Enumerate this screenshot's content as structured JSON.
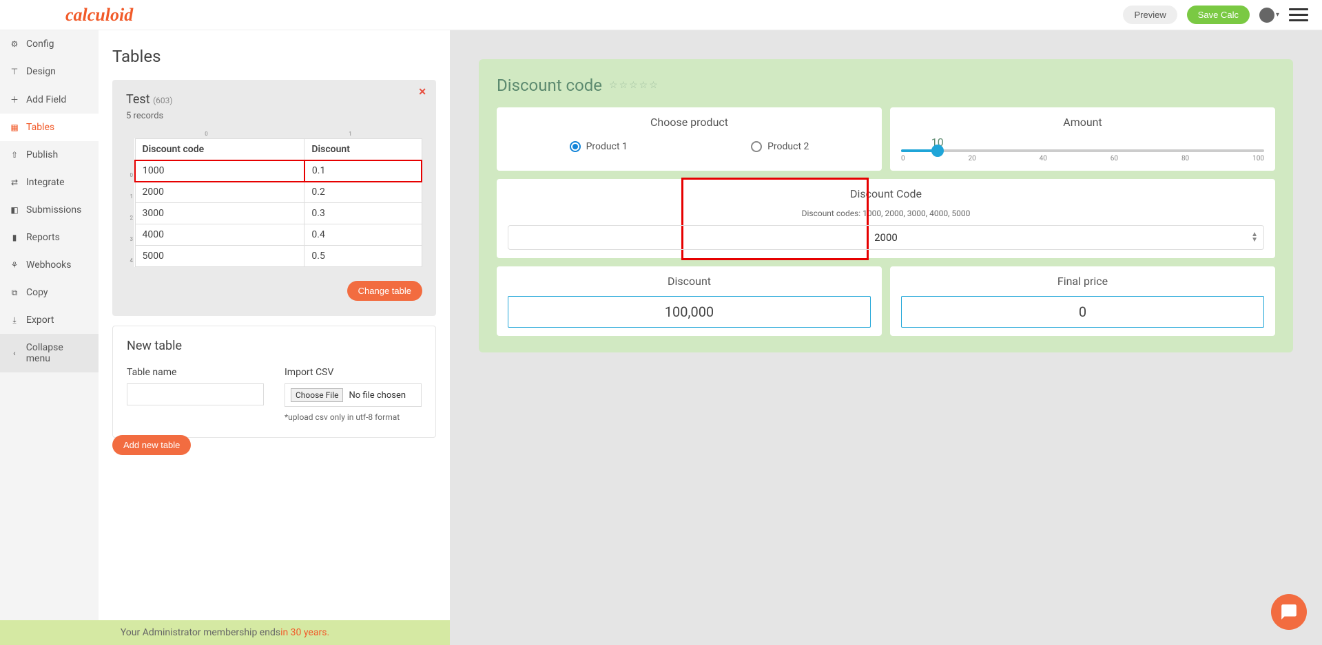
{
  "logo": "calculoid",
  "topbar": {
    "preview": "Preview",
    "save": "Save Calc"
  },
  "sidebar": {
    "items": [
      {
        "label": "Config"
      },
      {
        "label": "Design"
      },
      {
        "label": "Add Field"
      },
      {
        "label": "Tables"
      },
      {
        "label": "Publish"
      },
      {
        "label": "Integrate"
      },
      {
        "label": "Submissions"
      },
      {
        "label": "Reports"
      },
      {
        "label": "Webhooks"
      },
      {
        "label": "Copy"
      },
      {
        "label": "Export"
      }
    ],
    "collapse": "Collapse menu"
  },
  "tables": {
    "title": "Tables",
    "table_name": "Test",
    "table_id": "(603)",
    "record_text": "5 records",
    "col_index": [
      "0",
      "1"
    ],
    "row_index": [
      "0",
      "1",
      "2",
      "3",
      "4"
    ],
    "headers": [
      "Discount code",
      "Discount"
    ],
    "rows": [
      [
        "1000",
        "0.1"
      ],
      [
        "2000",
        "0.2"
      ],
      [
        "3000",
        "0.3"
      ],
      [
        "4000",
        "0.4"
      ],
      [
        "5000",
        "0.5"
      ]
    ],
    "change_btn": "Change table",
    "new_table_title": "New table",
    "table_name_label": "Table name",
    "import_csv_label": "Import CSV",
    "choose_file_btn": "Choose File",
    "no_file": "No file chosen",
    "upload_note": "*upload csv only in utf-8 format",
    "add_btn": "Add new table"
  },
  "membership": {
    "prefix": "Your Administrator membership ends ",
    "highlight": "in 30 years."
  },
  "calc": {
    "title": "Discount code",
    "product_card_title": "Choose product",
    "product1": "Product 1",
    "product2": "Product 2",
    "amount_title": "Amount",
    "slider_value": "10",
    "slider_ticks": [
      "0",
      "20",
      "40",
      "60",
      "80",
      "100"
    ],
    "discount_code_title": "Discount Code",
    "discount_hint": "Discount codes: 1000, 2000, 3000, 4000, 5000",
    "discount_code_value": "2000",
    "discount_title": "Discount",
    "discount_value": "100,000",
    "final_title": "Final price",
    "final_value": "0"
  }
}
